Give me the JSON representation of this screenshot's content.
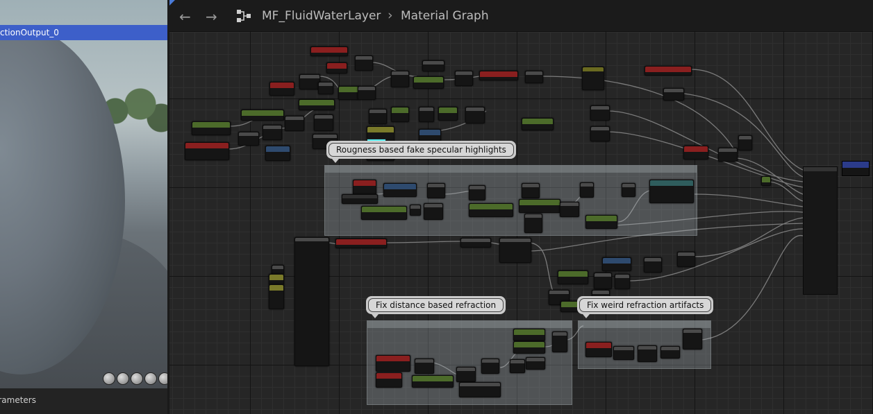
{
  "viewport": {
    "selected_output": "ctionOutput_0",
    "params_tab": "arameters"
  },
  "header": {
    "back_icon": "arrow-left-icon",
    "forward_icon": "arrow-right-icon",
    "graph_icon": "material-graph-icon",
    "breadcrumb_asset": "MF_FluidWaterLayer",
    "breadcrumb_separator": "›",
    "breadcrumb_graph": "Material Graph"
  },
  "comments": {
    "roughness": "Rougness based fake specular highlights",
    "distance": "Fix distance based refraction",
    "weird": "Fix weird refraction artifacts"
  },
  "colors": {
    "selected": "#3d5fc9",
    "swatch": "#58f3f5",
    "param_red": "#8a1f1f",
    "param_green": "#4c6b2a"
  }
}
